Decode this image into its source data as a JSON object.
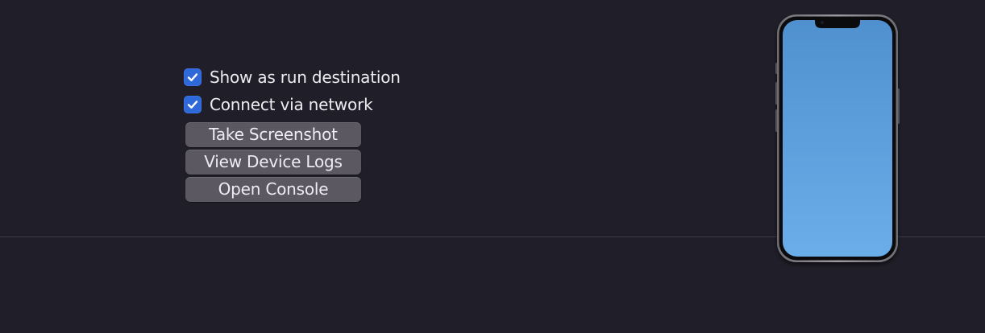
{
  "device_options": {
    "show_as_run_destination": {
      "label": "Show as run destination",
      "checked": true
    },
    "connect_via_network": {
      "label": "Connect via network",
      "checked": true
    }
  },
  "actions": {
    "take_screenshot_label": "Take Screenshot",
    "view_device_logs_label": "View Device Logs",
    "open_console_label": "Open Console"
  },
  "device_preview": {
    "icon": "iphone-device-icon",
    "screen_gradient_top": "#5090cf",
    "screen_gradient_bottom": "#6aaee9"
  },
  "colors": {
    "background": "#201e28",
    "checkbox_accent": "#2f68d8",
    "button_fill": "#5b5862",
    "text": "#ececf1"
  }
}
